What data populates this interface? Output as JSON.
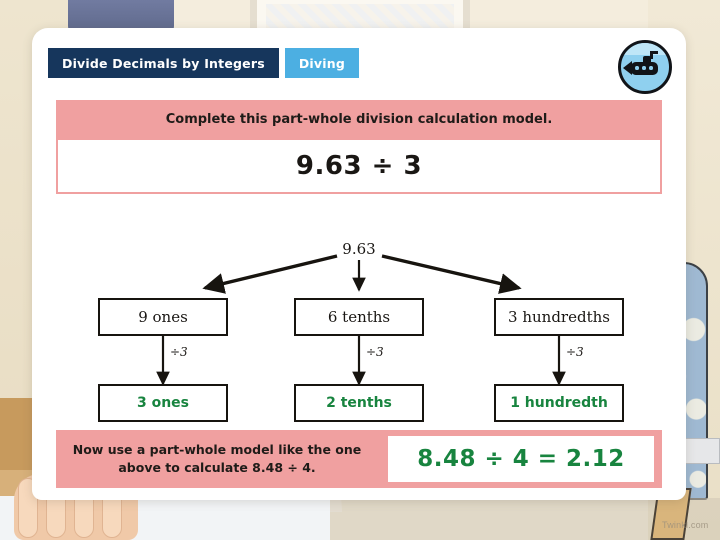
{
  "header": {
    "tab_primary": "Divide Decimals by Integers",
    "tab_secondary": "Diving",
    "logo_name": "submarine-logo"
  },
  "instruction": {
    "banner_text": "Complete this part-whole division calculation model.",
    "question": "9.63 ÷ 3"
  },
  "diagram": {
    "whole": "9.63",
    "parts": [
      {
        "label": "9 ones",
        "divisor": "÷3",
        "answer": "3 ones"
      },
      {
        "label": "6 tenths",
        "divisor": "÷3",
        "answer": "2 tenths"
      },
      {
        "label": "3 hundredths",
        "divisor": "÷3",
        "answer": "1 hundredth"
      }
    ]
  },
  "bottom": {
    "prompt": "Now use a part-whole model like the one above to calculate 8.48 ÷ 4.",
    "answer": "8.48 ÷ 4 = 2.12"
  },
  "watermark": "Twinkl.com",
  "colors": {
    "tab_primary_bg": "#16365c",
    "tab_secondary_bg": "#4cafe2",
    "banner_bg": "#f0a0a0",
    "answer_green": "#18843f",
    "text_dark": "#1a1714"
  }
}
